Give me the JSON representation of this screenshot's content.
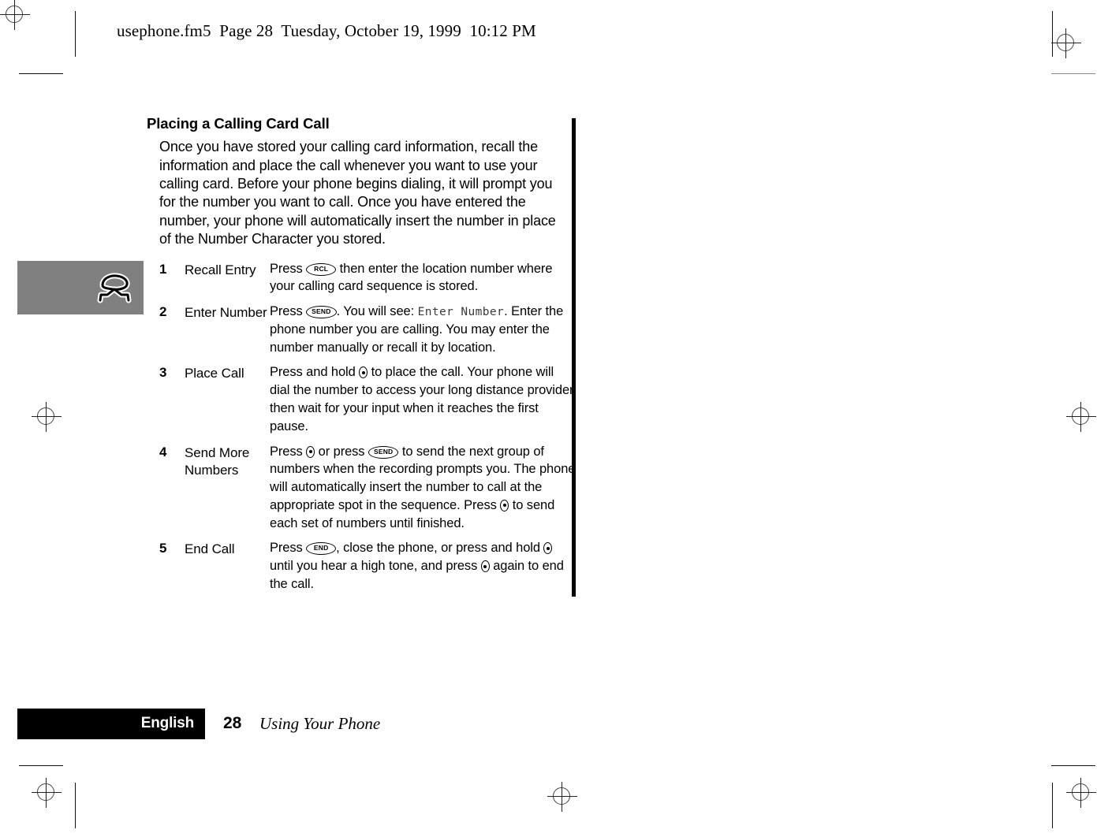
{
  "header": {
    "text": "usephone.fm5  Page 28  Tuesday, October 19, 1999  10:12 PM"
  },
  "side_tab": {
    "icon": "telephone-handset-icon",
    "background_color": "#808080"
  },
  "section": {
    "title": "Placing a Calling Card Call",
    "intro": "Once you have stored your calling card information, recall the information and place the call whenever you want to use your calling card. Before your phone begins dialing, it will prompt you for the number you want to call. Once you have entered the number, your phone will automatically insert the number in place of the Number Character you stored."
  },
  "steps": [
    {
      "number": "1",
      "label": "Recall Entry",
      "body_parts": [
        {
          "type": "text",
          "value": "Press "
        },
        {
          "type": "key_oval",
          "value": "RCL"
        },
        {
          "type": "text",
          "value": " then enter the location number where your calling card sequence is stored."
        }
      ]
    },
    {
      "number": "2",
      "label": "Enter Number",
      "body_parts": [
        {
          "type": "text",
          "value": "Press "
        },
        {
          "type": "key_oval",
          "value": "SEND"
        },
        {
          "type": "text",
          "value": ". You will see: "
        },
        {
          "type": "lcd",
          "value": "Enter Number"
        },
        {
          "type": "text",
          "value": ". Enter the phone number you are calling. You may enter the number manually or recall it by location."
        }
      ]
    },
    {
      "number": "3",
      "label": "Place Call",
      "body_parts": [
        {
          "type": "text",
          "value": "Press and hold "
        },
        {
          "type": "key_smart",
          "value": "smart-button"
        },
        {
          "type": "text",
          "value": " to place the call. Your phone will dial the number to access your long distance provider, then wait for your input when it reaches the first pause."
        }
      ]
    },
    {
      "number": "4",
      "label": "Send More Numbers",
      "body_parts": [
        {
          "type": "text",
          "value": "Press "
        },
        {
          "type": "key_smart",
          "value": "smart-button"
        },
        {
          "type": "text",
          "value": " or press "
        },
        {
          "type": "key_oval",
          "value": "SEND"
        },
        {
          "type": "text",
          "value": " to send the next group of numbers when the recording prompts you. The phone will automatically insert the number to call at the appropriate spot in the sequence. Press "
        },
        {
          "type": "key_smart",
          "value": "smart-button"
        },
        {
          "type": "text",
          "value": " to send each set of numbers until finished."
        }
      ]
    },
    {
      "number": "5",
      "label": "End Call",
      "body_parts": [
        {
          "type": "text",
          "value": "Press "
        },
        {
          "type": "key_oval",
          "value": "END"
        },
        {
          "type": "text",
          "value": ", close the phone, or press and hold "
        },
        {
          "type": "key_smart",
          "value": "smart-button"
        },
        {
          "type": "text",
          "value": " until you hear a high tone, and press "
        },
        {
          "type": "key_smart",
          "value": "smart-button"
        },
        {
          "type": "text",
          "value": " again to end the call."
        }
      ]
    }
  ],
  "footer": {
    "language": "English",
    "page_number": "28",
    "chapter": "Using Your Phone"
  }
}
